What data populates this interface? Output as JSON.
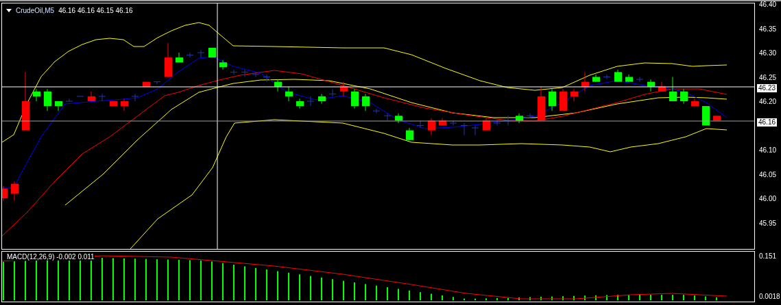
{
  "chart": {
    "symbol": "CrudeOil,M5",
    "quote": "46.16 46.16 46.15 46.16"
  },
  "price_axis": {
    "ticks": [
      "46.40",
      "46.35",
      "46.30",
      "46.25",
      "46.20",
      "46.10",
      "46.05",
      "46.00",
      "45.95"
    ],
    "tags": [
      {
        "kind": "crosshair",
        "label": "46.23"
      },
      {
        "kind": "bid",
        "label": "46.16"
      }
    ]
  },
  "macd": {
    "label": "MACD(12,26,9) -0.002 0.011",
    "ticks": [
      "0.151",
      "0.0018"
    ]
  }
}
